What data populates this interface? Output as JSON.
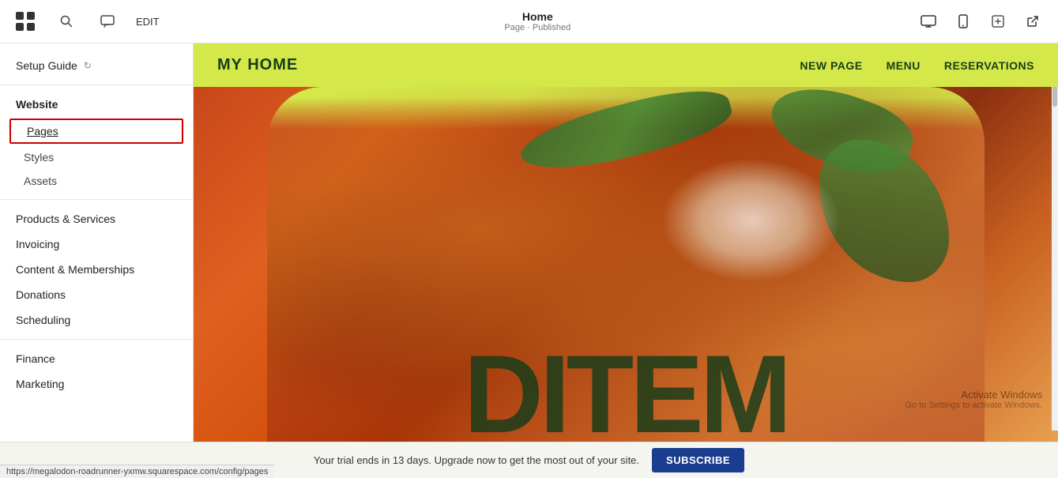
{
  "topbar": {
    "edit_label": "EDIT",
    "page_title": "Home",
    "page_subtitle": "Page · Published"
  },
  "sidebar": {
    "setup_guide": "Setup Guide",
    "website_label": "Website",
    "pages_item": "Pages",
    "styles_item": "Styles",
    "assets_item": "Assets",
    "products_services": "Products & Services",
    "invoicing": "Invoicing",
    "content_memberships": "Content & Memberships",
    "donations": "Donations",
    "scheduling": "Scheduling",
    "finance": "Finance",
    "marketing": "Marketing"
  },
  "preview": {
    "nav_logo": "MY HOME",
    "nav_links": [
      "NEW PAGE",
      "MENU",
      "RESERVATIONS"
    ],
    "big_text": "DITEM"
  },
  "bottombar": {
    "trial_text": "Your trial ends in 13 days. Upgrade now to get the most out of your site.",
    "subscribe_label": "SUBSCRIBE"
  },
  "url_bar": {
    "url": "https://megalodon-roadrunner-yxmw.squarespace.com/config/pages"
  },
  "activation": {
    "line1": "Activate Windows",
    "line2": "Go to Settings to activate Windows."
  },
  "icons": {
    "squarespace": "⬛",
    "search": "🔍",
    "comment": "💬",
    "desktop": "🖥",
    "mobile": "📱",
    "edit_tool": "✏",
    "external": "↗",
    "setup_spinner": "↻"
  }
}
